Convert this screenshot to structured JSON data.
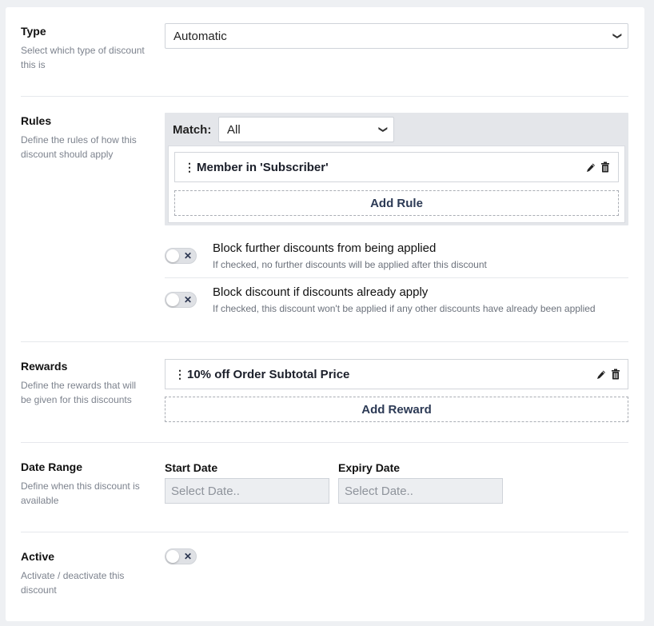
{
  "type_section": {
    "title": "Type",
    "description": "Select which type of discount this is",
    "selected": "Automatic"
  },
  "rules_section": {
    "title": "Rules",
    "description": "Define the rules of how this discount should apply",
    "match_label": "Match:",
    "match_selected": "All",
    "rules": [
      {
        "label": "Member in 'Subscriber'"
      }
    ],
    "add_rule_label": "Add Rule",
    "options": [
      {
        "title": "Block further discounts from being applied",
        "description": "If checked, no further discounts will be applied after this discount",
        "checked": false
      },
      {
        "title": "Block discount if discounts already apply",
        "description": "If checked, this discount won't be applied if any other discounts have already been applied",
        "checked": false
      }
    ]
  },
  "rewards_section": {
    "title": "Rewards",
    "description": "Define the rewards that will be given for this discounts",
    "rewards": [
      {
        "label": "10% off Order Subtotal Price"
      }
    ],
    "add_reward_label": "Add Reward"
  },
  "date_section": {
    "title": "Date Range",
    "description": "Define when this discount is available",
    "start_label": "Start Date",
    "start_placeholder": "Select Date..",
    "expiry_label": "Expiry Date",
    "expiry_placeholder": "Select Date.."
  },
  "active_section": {
    "title": "Active",
    "description": "Activate / deactivate this discount",
    "checked": false
  },
  "icons": {
    "toggle_off": "x-icon",
    "edit": "pencil-icon",
    "delete": "trash-icon",
    "drag": "drag-handle-icon",
    "dropdown": "chevron-down-icon"
  },
  "colors": {
    "accent_text": "#2c3a55",
    "muted_text": "#7d838e",
    "rules_bg": "#e4e6ea"
  }
}
